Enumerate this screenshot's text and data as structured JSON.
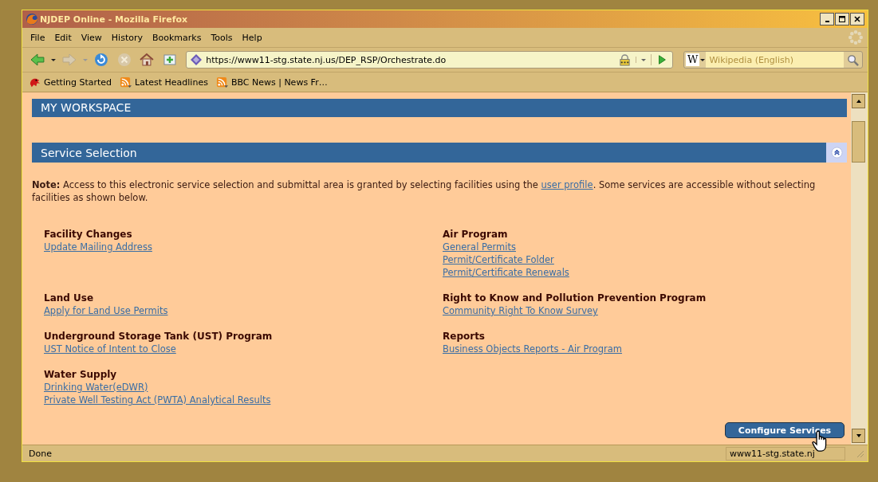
{
  "window": {
    "title": "NJDEP Online - Mozilla Firefox"
  },
  "menu": [
    "File",
    "Edit",
    "View",
    "History",
    "Bookmarks",
    "Tools",
    "Help"
  ],
  "navigation": {
    "url": "https://www11-stg.state.nj.us/DEP_RSP/Orchestrate.do",
    "search": {
      "engine": "W",
      "placeholder": "Wikipedia (English)"
    }
  },
  "bookmarks": [
    {
      "label": "Getting Started",
      "kind": "page"
    },
    {
      "label": "Latest Headlines",
      "kind": "feed"
    },
    {
      "label": "BBC News | News Fr…",
      "kind": "feed"
    }
  ],
  "page": {
    "header": "MY WORKSPACE",
    "panel_title": "Service Selection",
    "note": {
      "before": "**Note:** Access to this electronic service selection and submittal area is granted by selecting facilities using the ",
      "link": "user profile",
      "after": ". Some services are accessible without selecting facilities as shown below."
    },
    "columns": [
      {
        "groups": [
          {
            "heading": "Facility Changes",
            "links": [
              "Update Mailing Address"
            ]
          },
          {
            "heading": "Land Use",
            "links": [
              "Apply for Land Use Permits"
            ]
          },
          {
            "heading": "Underground Storage Tank (UST) Program",
            "links": [
              "UST Notice of Intent to Close"
            ]
          },
          {
            "heading": "Water Supply",
            "links": [
              "Drinking Water(eDWR)",
              "Private Well Testing Act (PWTA) Analytical Results"
            ]
          }
        ]
      },
      {
        "groups": [
          {
            "heading": "Air Program",
            "links": [
              "General Permits",
              "Permit/Certificate Folder",
              "Permit/Certificate Renewals"
            ]
          },
          {
            "heading": "Right to Know and Pollution Prevention Program",
            "links": [
              "Community Right To Know Survey"
            ]
          },
          {
            "heading": "Reports",
            "links": [
              "Business Objects Reports - Air Program"
            ]
          }
        ]
      }
    ],
    "button": "Configure Services"
  },
  "status_bar": {
    "text": "Done",
    "url": "www11-stg.state.nj"
  }
}
